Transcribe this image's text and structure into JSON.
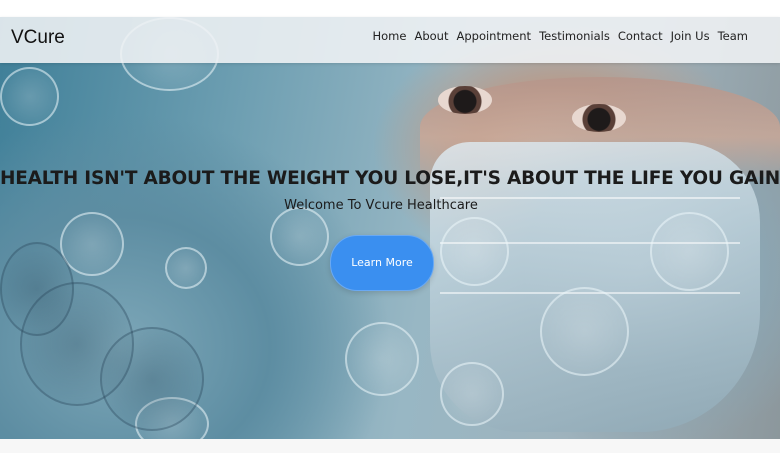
{
  "navbar": {
    "brand": "VCure",
    "links": [
      {
        "label": "Home"
      },
      {
        "label": "About"
      },
      {
        "label": "Appointment"
      },
      {
        "label": "Testimonials"
      },
      {
        "label": "Contact"
      },
      {
        "label": "Join Us"
      },
      {
        "label": "Team"
      }
    ]
  },
  "hero": {
    "headline": "HEALTH ISN'T ABOUT THE WEIGHT YOU LOSE,IT'S ABOUT THE LIFE YOU GAIN",
    "subtitle": "Welcome To Vcure Healthcare",
    "cta_label": "Learn More"
  },
  "colors": {
    "cta": "#3a8ff0",
    "navbar_bg": "#f0f3f5",
    "text": "#1b1b1b"
  }
}
